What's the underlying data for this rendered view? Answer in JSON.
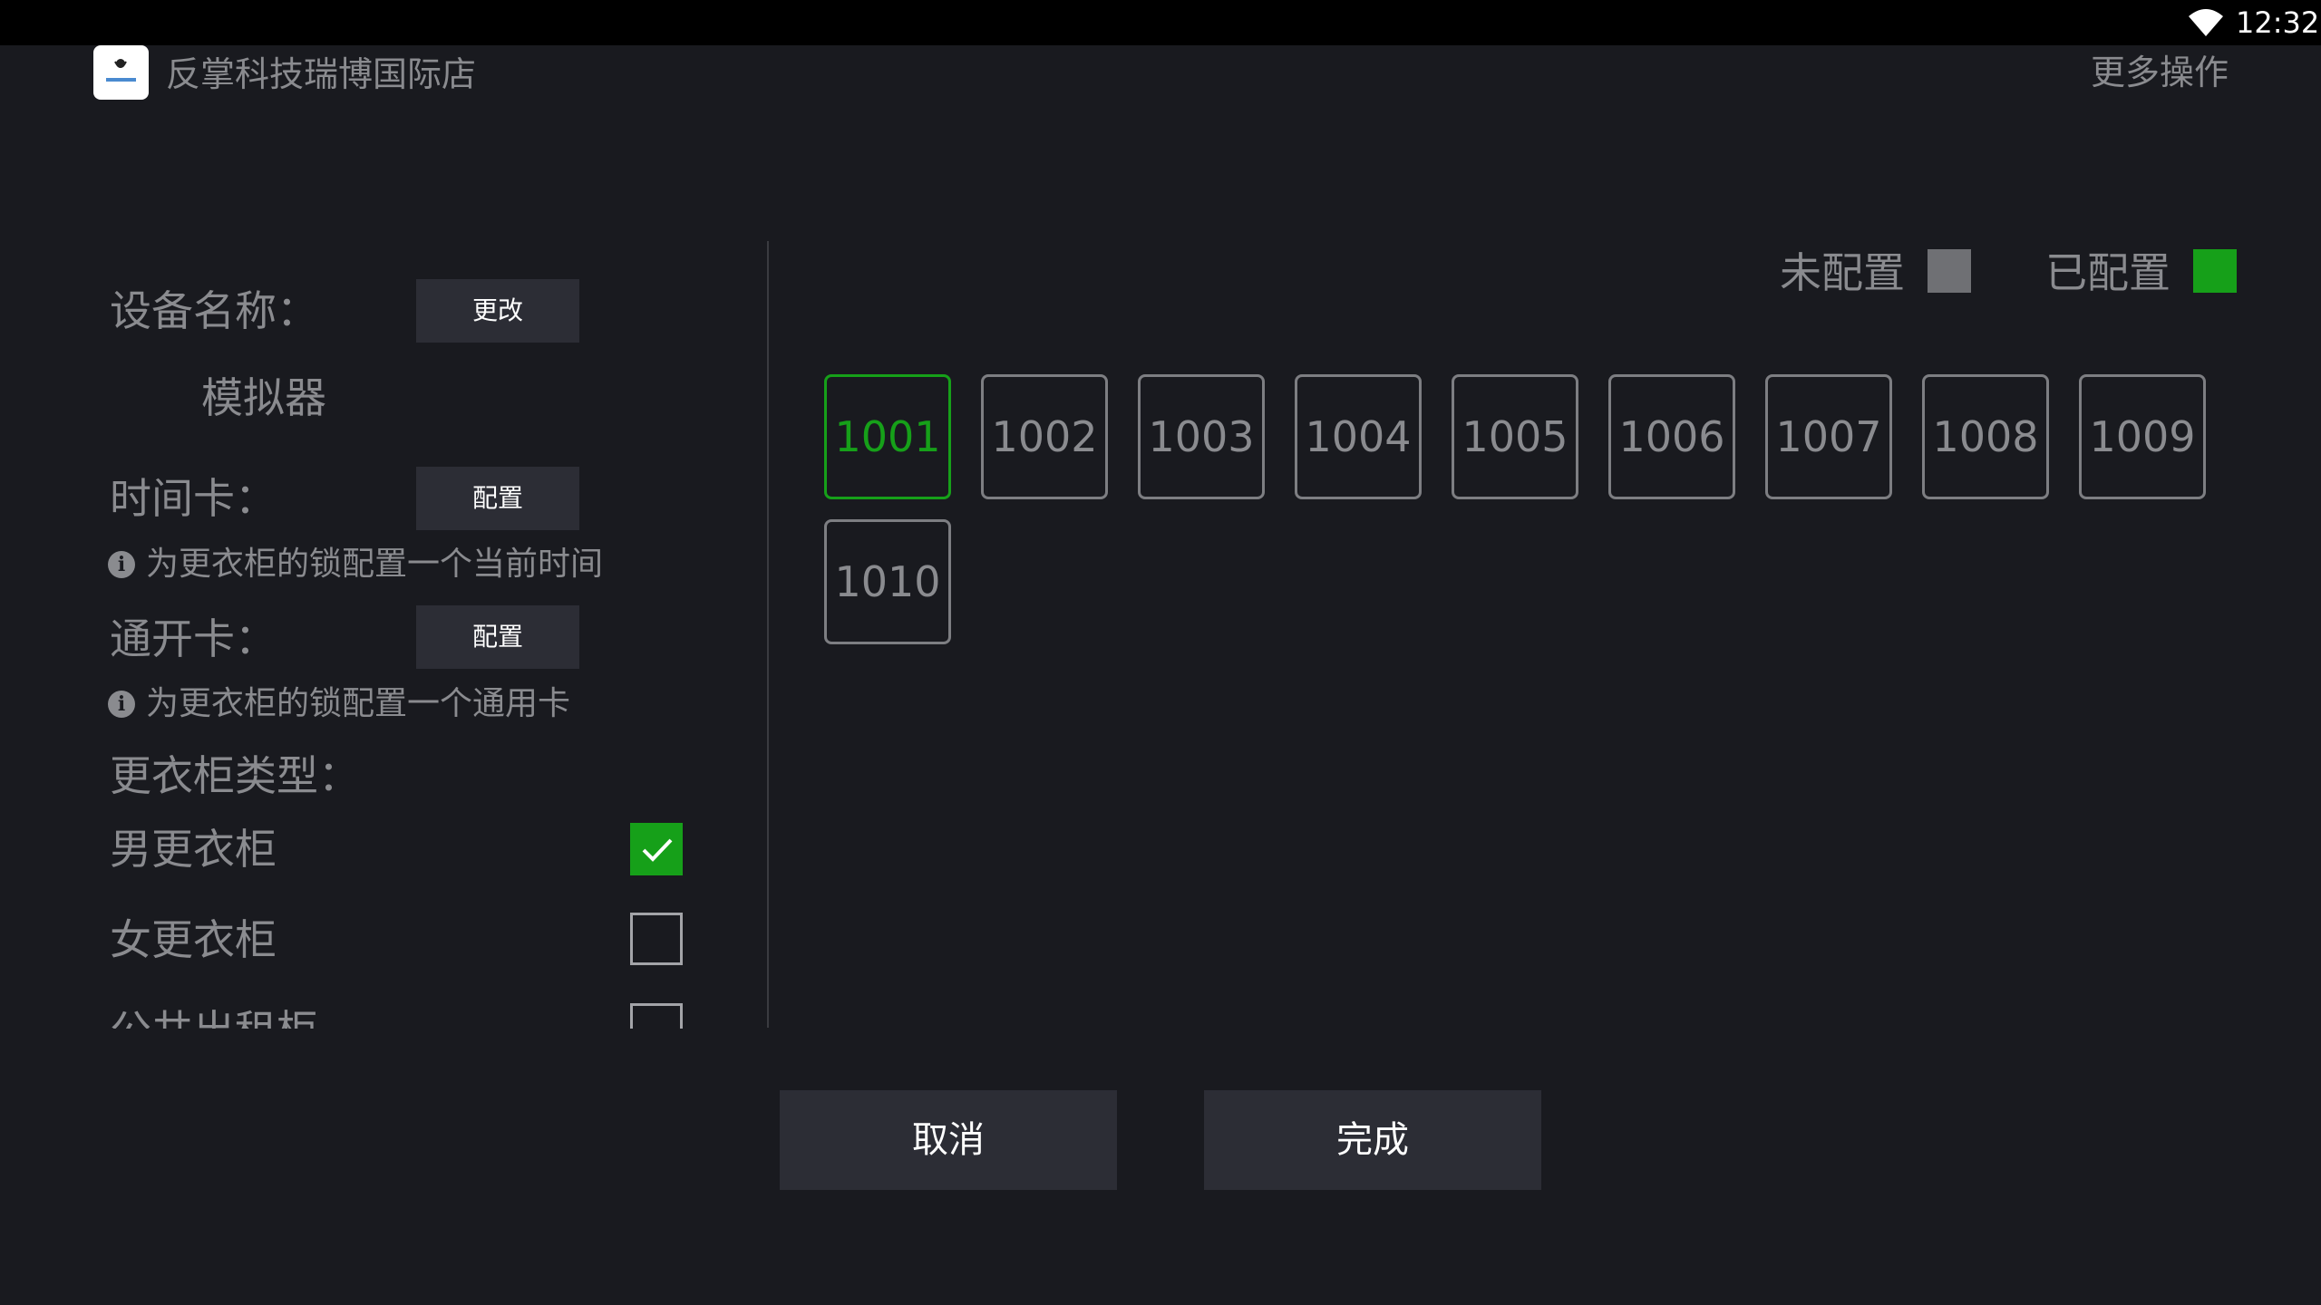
{
  "status_bar": {
    "time": "12:32",
    "wifi_icon": "wifi-icon"
  },
  "app_bar": {
    "logo_icon": "app-logo-icon",
    "title": "反掌科技瑞博国际店",
    "more_actions": "更多操作"
  },
  "settings": {
    "device_name_label": "设备名称：",
    "device_name_change": "更改",
    "device_name_value": "模拟器",
    "time_card_label": "时间卡：",
    "time_card_button": "配置",
    "time_card_hint": "为更衣柜的锁配置一个当前时间",
    "master_card_label": "通开卡：",
    "master_card_button": "配置",
    "master_card_hint": "为更衣柜的锁配置一个通用卡",
    "locker_type_label": "更衣柜类型：",
    "locker_types": [
      {
        "label": "男更衣柜",
        "checked": true
      },
      {
        "label": "女更衣柜",
        "checked": false
      },
      {
        "label": "公共出租柜",
        "checked": false
      }
    ]
  },
  "legend": {
    "unconfigured": "未配置",
    "unconfigured_color": "#6f7074",
    "configured": "已配置",
    "configured_color": "#16a019"
  },
  "lockers": [
    {
      "id": "1001",
      "configured": true
    },
    {
      "id": "1002",
      "configured": false
    },
    {
      "id": "1003",
      "configured": false
    },
    {
      "id": "1004",
      "configured": false
    },
    {
      "id": "1005",
      "configured": false
    },
    {
      "id": "1006",
      "configured": false
    },
    {
      "id": "1007",
      "configured": false
    },
    {
      "id": "1008",
      "configured": false
    },
    {
      "id": "1009",
      "configured": false
    },
    {
      "id": "1010",
      "configured": false
    }
  ],
  "actions": {
    "cancel": "取消",
    "done": "完成"
  }
}
